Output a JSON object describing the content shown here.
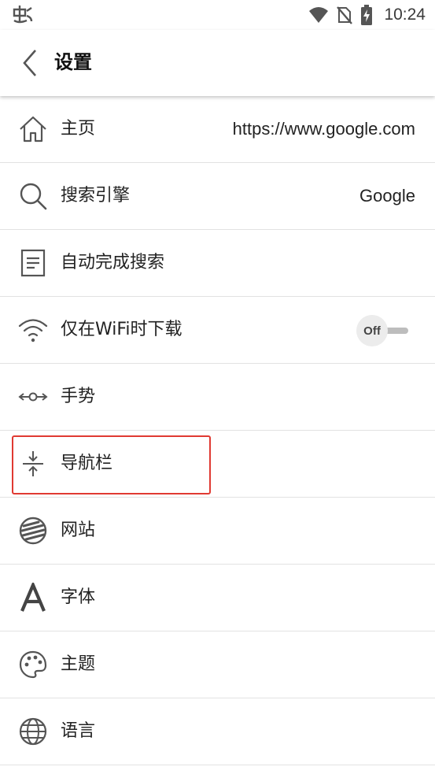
{
  "status_bar": {
    "time": "10:24",
    "icons": [
      "app-notification-icon",
      "wifi-icon",
      "no-sim-icon",
      "battery-charging-icon"
    ]
  },
  "app_bar": {
    "title": "设置",
    "back_icon": "chevron-left-icon"
  },
  "settings": {
    "items": [
      {
        "label": "主页",
        "icon": "home-icon",
        "value": "https://www.google.com"
      },
      {
        "label": "搜索引擎",
        "icon": "search-icon",
        "value": "Google"
      },
      {
        "label": "自动完成搜索",
        "icon": "document-icon"
      },
      {
        "label": "仅在WiFi时下载",
        "icon": "wifi-icon",
        "toggle": {
          "state": "Off"
        }
      },
      {
        "label": "手势",
        "icon": "swipe-gesture-icon"
      },
      {
        "label": "导航栏",
        "icon": "compress-vertical-icon",
        "highlighted": true
      },
      {
        "label": "网站",
        "icon": "website-icon"
      },
      {
        "label": "字体",
        "icon": "font-icon"
      },
      {
        "label": "主题",
        "icon": "palette-icon"
      },
      {
        "label": "语言",
        "icon": "globe-icon"
      }
    ]
  },
  "colors": {
    "highlight": "#e03a32",
    "divider": "#e2e2e2",
    "text": "#222222"
  }
}
